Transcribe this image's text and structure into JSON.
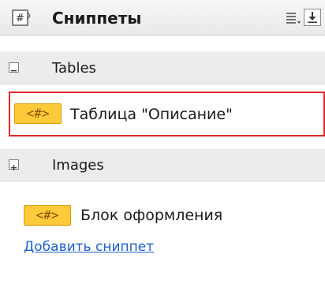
{
  "header": {
    "title": "Сниппеты",
    "logo_icon": "hash-tag-icon",
    "menu_icon": "list-menu-icon",
    "download_icon": "download-icon"
  },
  "categories": [
    {
      "label": "Tables",
      "expanded": true,
      "toggle_glyph": "−",
      "snippets": [
        {
          "badge": "<#>",
          "label": "Таблица \"Описание\"",
          "highlighted": true
        }
      ]
    },
    {
      "label": "Images",
      "expanded": false,
      "toggle_glyph": "+",
      "snippets": []
    }
  ],
  "loose_snippets": [
    {
      "badge": "<#>",
      "label": "Блок оформления"
    }
  ],
  "add_link": "Добавить сниппет",
  "colors": {
    "badge": "#ffca3a",
    "highlight_border": "#e0282c",
    "link": "#1f5fd0"
  }
}
